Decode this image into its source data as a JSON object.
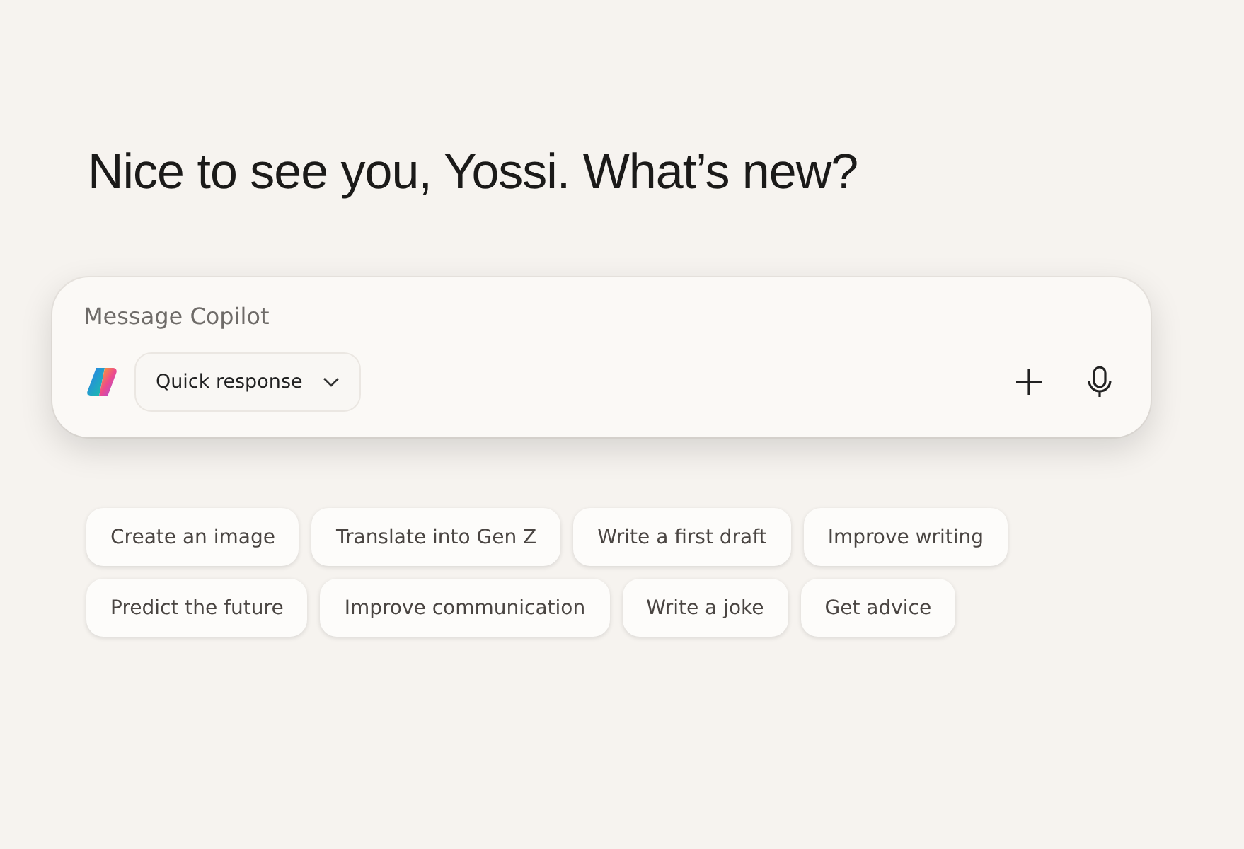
{
  "greeting": "Nice to see you, Yossi. What’s new?",
  "composer": {
    "placeholder": "Message Copilot",
    "mode": "Quick response"
  },
  "suggestion_rows": [
    [
      "Create an image",
      "Translate into Gen Z",
      "Write a first draft",
      "Improve writing"
    ],
    [
      "Predict the future",
      "Improve communication",
      "Write a joke",
      "Get advice"
    ]
  ]
}
